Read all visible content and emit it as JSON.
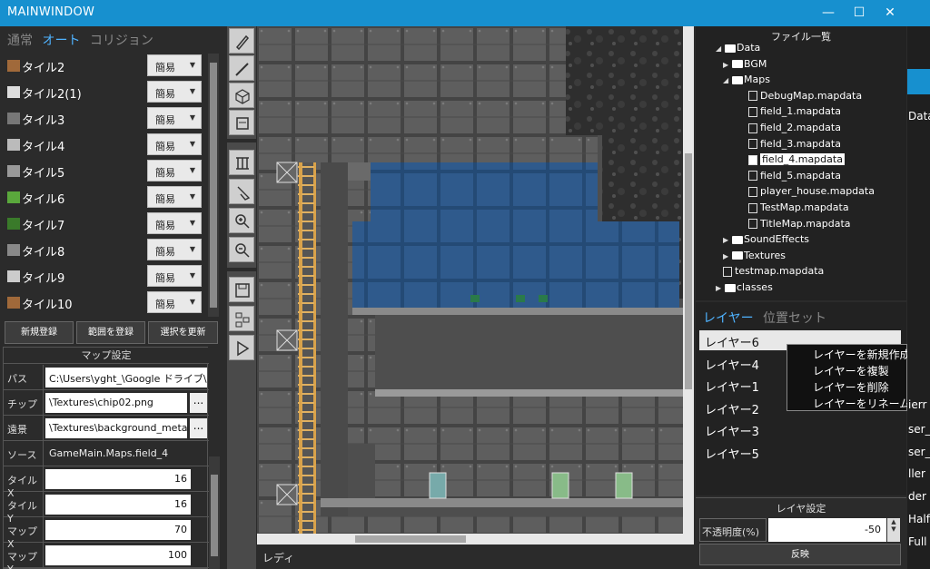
{
  "window": {
    "title": "MAINWINDOW",
    "controls": [
      "—",
      "☐",
      "✕"
    ]
  },
  "tile_tabs": [
    "通常",
    "オート",
    "コリジョン"
  ],
  "tiles": [
    {
      "name": "タイル2",
      "mode": "簡易",
      "color": "#a0693a"
    },
    {
      "name": "タイル2(1)",
      "mode": "簡易",
      "color": "#dddddd"
    },
    {
      "name": "タイル3",
      "mode": "簡易",
      "color": "#777777"
    },
    {
      "name": "タイル4",
      "mode": "簡易",
      "color": "#bbbbbb"
    },
    {
      "name": "タイル5",
      "mode": "簡易",
      "color": "#999999"
    },
    {
      "name": "タイル6",
      "mode": "簡易",
      "color": "#5aa83c"
    },
    {
      "name": "タイル7",
      "mode": "簡易",
      "color": "#3a7a2a"
    },
    {
      "name": "タイル8",
      "mode": "簡易",
      "color": "#888888"
    },
    {
      "name": "タイル9",
      "mode": "簡易",
      "color": "#cccccc"
    },
    {
      "name": "タイル10",
      "mode": "簡易",
      "color": "#a0693a"
    }
  ],
  "tile_buttons": [
    "新規登録",
    "範囲を登録",
    "選択を更新"
  ],
  "map_settings": {
    "title": "マップ設定",
    "path_label": "パス",
    "path_value": "C:\\Users\\yght_\\Google ドライブ\\Ga",
    "chip_label": "チップ",
    "chip_value": "\\Textures\\chip02.png",
    "bg_label": "遠景",
    "bg_value": "\\Textures\\background_metal",
    "source_label": "ソース",
    "source_value": "GameMain.Maps.field_4",
    "tilex_label": "タイルX",
    "tilex_value": "16",
    "tiley_label": "タイルY",
    "tiley_value": "16",
    "mapx_label": "マップX",
    "mapx_value": "70",
    "mapy_label": "マップY",
    "mapy_value": "100",
    "browse": "..."
  },
  "status_text": "レディ",
  "files": {
    "title": "ファイル一覧",
    "nodes": [
      {
        "label": "Data",
        "indent": 0,
        "type": "folder",
        "arrow": "◢"
      },
      {
        "label": "BGM",
        "indent": 1,
        "type": "folder",
        "arrow": "▶"
      },
      {
        "label": "Maps",
        "indent": 1,
        "type": "folder",
        "arrow": "◢"
      },
      {
        "label": "DebugMap.mapdata",
        "indent": 2,
        "type": "file"
      },
      {
        "label": "field_1.mapdata",
        "indent": 2,
        "type": "file"
      },
      {
        "label": "field_2.mapdata",
        "indent": 2,
        "type": "file"
      },
      {
        "label": "field_3.mapdata",
        "indent": 2,
        "type": "file"
      },
      {
        "label": "field_4.mapdata",
        "indent": 2,
        "type": "file",
        "selected": true
      },
      {
        "label": "field_5.mapdata",
        "indent": 2,
        "type": "file"
      },
      {
        "label": "player_house.mapdata",
        "indent": 2,
        "type": "file"
      },
      {
        "label": "TestMap.mapdata",
        "indent": 2,
        "type": "file"
      },
      {
        "label": "TitleMap.mapdata",
        "indent": 2,
        "type": "file"
      },
      {
        "label": "SoundEffects",
        "indent": 1,
        "type": "folder",
        "arrow": "▶"
      },
      {
        "label": "Textures",
        "indent": 1,
        "type": "folder",
        "arrow": "▶"
      },
      {
        "label": "testmap.mapdata",
        "indent": 1,
        "type": "file"
      },
      {
        "label": "classes",
        "indent": 0,
        "type": "folder",
        "arrow": "▶"
      }
    ]
  },
  "layer_tabs": [
    "レイヤー",
    "位置セット"
  ],
  "layers": [
    "レイヤー6",
    "レイヤー4",
    "レイヤー1",
    "レイヤー2",
    "レイヤー3",
    "レイヤー5"
  ],
  "context_menu": [
    "レイヤーを新規作成",
    "レイヤーを複製",
    "レイヤーを削除",
    "レイヤーをリネーム"
  ],
  "layer_settings": {
    "title": "レイヤ設定",
    "opacity_label": "不透明度(%)",
    "opacity_value": "-50",
    "apply_label": "反映"
  },
  "background_window": {
    "texts": [
      "Data",
      "ierr",
      "ser_L",
      "ser_F",
      "ller",
      "der",
      "Half",
      "Full"
    ]
  },
  "colors": {
    "accent": "#1790cf",
    "tab_active": "#4fb3ff",
    "water": "#2f5a8c"
  }
}
